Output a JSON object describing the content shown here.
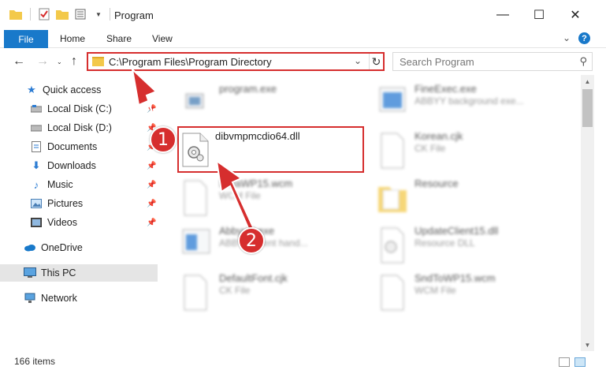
{
  "window": {
    "title": "Program",
    "controls": {
      "minimize": "—",
      "maximize": "☐",
      "close": "✕"
    }
  },
  "ribbon": {
    "tabs": [
      "File",
      "Home",
      "Share",
      "View"
    ],
    "help": "?"
  },
  "navigation": {
    "address_path": "C:\\Program Files\\Program Directory",
    "search_placeholder": "Search Program"
  },
  "sidebar": {
    "items": [
      {
        "label": "Quick access",
        "icon": "star-icon",
        "pinned": false
      },
      {
        "label": "Local Disk (C:)",
        "icon": "drive-icon",
        "pinned": true
      },
      {
        "label": "Local Disk (D:)",
        "icon": "drive-icon",
        "pinned": true
      },
      {
        "label": "Documents",
        "icon": "documents-icon",
        "pinned": true
      },
      {
        "label": "Downloads",
        "icon": "downloads-icon",
        "pinned": true
      },
      {
        "label": "Music",
        "icon": "music-icon",
        "pinned": true
      },
      {
        "label": "Pictures",
        "icon": "pictures-icon",
        "pinned": true
      },
      {
        "label": "Videos",
        "icon": "videos-icon",
        "pinned": true
      },
      {
        "label": "OneDrive",
        "icon": "cloud-icon",
        "pinned": false
      },
      {
        "label": "This PC",
        "icon": "pc-icon",
        "pinned": false
      },
      {
        "label": "Network",
        "icon": "network-icon",
        "pinned": false
      }
    ]
  },
  "files": [
    {
      "name": "program.exe",
      "type": ""
    },
    {
      "name": "FineExec.exe",
      "type": "ABBYY background exe..."
    },
    {
      "name": "dibvmpmcdio64.dll",
      "type": ""
    },
    {
      "name": "Korean.cjk",
      "type": "CK File"
    },
    {
      "name": "DefaWP15.wcm",
      "type": "WCM File"
    },
    {
      "name": "Resource",
      "type": ""
    },
    {
      "name": "AbbyyR.exe",
      "type": "ABBYY event hand..."
    },
    {
      "name": "UpdateClient15.dll",
      "type": "Resource DLL"
    },
    {
      "name": "DefaultFont.cjk",
      "type": "CK File"
    },
    {
      "name": "SndToWP15.wcm",
      "type": "WCM File"
    }
  ],
  "annotations": {
    "step1": "1",
    "step2": "2"
  },
  "status": {
    "item_count": "166 items"
  },
  "colors": {
    "accent": "#1979ca",
    "highlight": "#d62e2e"
  }
}
